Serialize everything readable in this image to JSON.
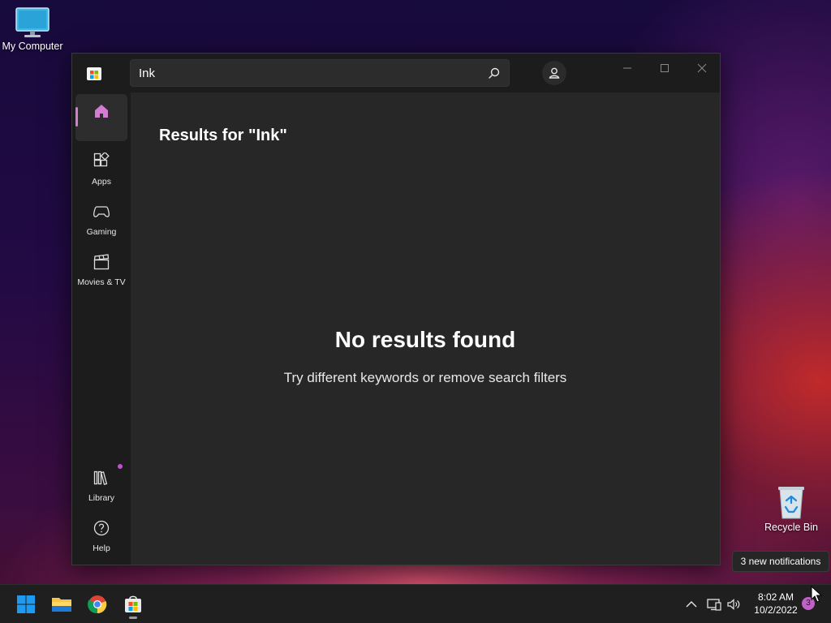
{
  "desktop": {
    "my_computer_label": "My Computer",
    "recycle_bin_label": "Recycle Bin"
  },
  "window": {
    "search": {
      "value": "Ink",
      "placeholder": ""
    },
    "sidebar": {
      "items": [
        {
          "label": "",
          "icon": "home-icon"
        },
        {
          "label": "Apps",
          "icon": "apps-icon"
        },
        {
          "label": "Gaming",
          "icon": "gamepad-icon"
        },
        {
          "label": "Movies & TV",
          "icon": "clapperboard-icon"
        },
        {
          "label": "Library",
          "icon": "library-icon"
        },
        {
          "label": "Help",
          "icon": "help-icon"
        }
      ]
    },
    "content": {
      "results_title": "Results for \"Ink\"",
      "empty_title": "No results found",
      "empty_subtitle": "Try different keywords or remove search filters"
    }
  },
  "notification_toast": "3 new notifications",
  "taskbar": {
    "time": "8:02 AM",
    "date": "10/2/2022",
    "notification_count": "3"
  },
  "colors": {
    "accent": "#d47bd3",
    "window_bg": "#202020",
    "content_bg": "#272727",
    "taskbar_bg": "#1f1f1f"
  }
}
